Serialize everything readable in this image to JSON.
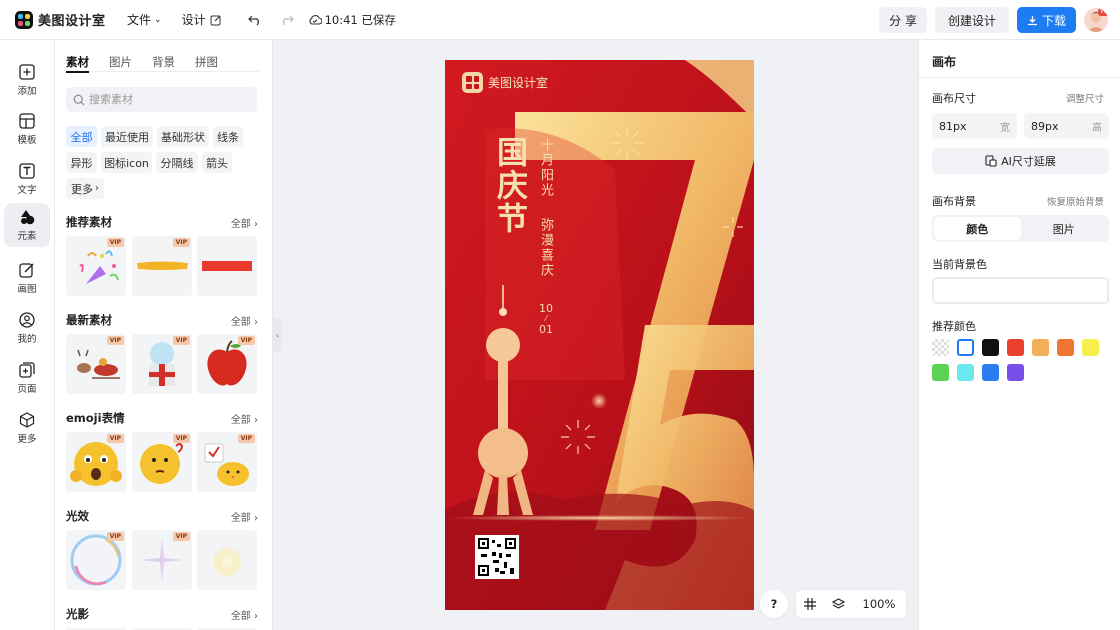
{
  "app": {
    "name": "美图设计室"
  },
  "topbar": {
    "file_menu": "文件",
    "design_menu": "设计",
    "save_status": "10:41 已保存",
    "share": "分 享",
    "create": "创建设计",
    "download": "下载",
    "avatar_badge": "VIP"
  },
  "left_nav": {
    "items": [
      {
        "label": "添加",
        "icon": "plus-square-icon"
      },
      {
        "label": "模板",
        "icon": "template-icon"
      },
      {
        "label": "文字",
        "icon": "text-icon"
      },
      {
        "label": "元素",
        "icon": "shapes-icon"
      },
      {
        "label": "画图",
        "icon": "pen-icon"
      },
      {
        "label": "我的",
        "icon": "user-icon"
      },
      {
        "label": "页面",
        "icon": "page-add-icon"
      },
      {
        "label": "更多",
        "icon": "cube-icon"
      }
    ],
    "active_index": 3
  },
  "material_panel": {
    "tabs": [
      "素材",
      "图片",
      "背景",
      "拼图"
    ],
    "active_tab": 0,
    "search_placeholder": "搜索素材",
    "filters": [
      "全部",
      "最近使用",
      "基础形状",
      "线条",
      "异形",
      "图标icon",
      "分隔线",
      "箭头",
      "更多"
    ],
    "active_filter": 0,
    "sections": [
      {
        "title": "推荐素材",
        "all": "全部",
        "items": [
          "confetti-popper",
          "yellow-brush-stroke",
          "red-bar"
        ],
        "vip": [
          true,
          true,
          false
        ]
      },
      {
        "title": "最新素材",
        "all": "全部",
        "items": [
          "reindeer-sleigh",
          "gift-snowglobe",
          "red-apple"
        ],
        "vip": [
          true,
          true,
          true
        ]
      },
      {
        "title": "emoji表情",
        "all": "全部",
        "items": [
          "shocked-emoji",
          "thinking-emoji",
          "chick-emoji"
        ],
        "vip": [
          true,
          true,
          true
        ]
      },
      {
        "title": "光效",
        "all": "全部",
        "items": [
          "bubble-ring",
          "star-sparkle",
          "glow-dot"
        ],
        "vip": [
          true,
          true,
          false
        ]
      },
      {
        "title": "光影",
        "all": "全部",
        "items": [],
        "vip": []
      }
    ],
    "vip_label": "VIP"
  },
  "poster": {
    "brand": "美图设计室",
    "title": "国庆节",
    "sub1": "十月阳光",
    "sub2": "弥漫喜庆",
    "date_top": "10",
    "date_bottom": "01",
    "big_number": "75",
    "colors": {
      "bg": "#c8141c",
      "gold": "#f0c77a"
    }
  },
  "floating": {
    "help": "?",
    "zoom": "100%"
  },
  "right_panel": {
    "title": "画布",
    "size_label": "画布尺寸",
    "resize_link": "调整尺寸",
    "width_value": "81px",
    "width_unit": "宽",
    "height_value": "89px",
    "height_unit": "高",
    "ai_extend": "AI尺寸延展",
    "bg_label": "画布背景",
    "restore_link": "恢复原始背景",
    "seg": [
      "颜色",
      "图片"
    ],
    "current_bg_label": "当前背景色",
    "recommended_label": "推荐颜色",
    "swatches": [
      "transparent",
      "#ffffff",
      "#111111",
      "#e8402c",
      "#f3b059",
      "#ee7630",
      "#f7f04c",
      "#5bd357",
      "#6ae8f0",
      "#2a7cf0",
      "#7a4ee8"
    ]
  }
}
